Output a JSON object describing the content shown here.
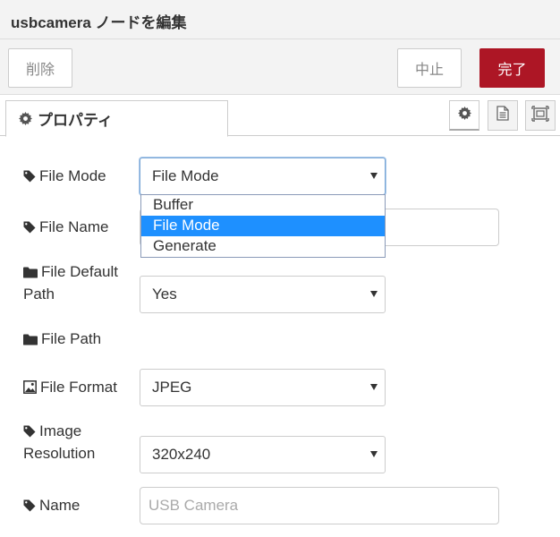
{
  "header": {
    "title": "usbcamera ノードを編集"
  },
  "toolbar": {
    "delete_label": "削除",
    "cancel_label": "中止",
    "done_label": "完了"
  },
  "tabs": {
    "properties_label": "プロパティ"
  },
  "form": {
    "file_mode": {
      "label": "File Mode",
      "value": "File Mode",
      "options": [
        "Buffer",
        "File Mode",
        "Generate"
      ]
    },
    "file_name": {
      "label": "File Name",
      "value": ""
    },
    "file_default_path": {
      "label_line1": "File Default",
      "label_line2": "Path",
      "value": "Yes"
    },
    "file_path": {
      "label": "File Path"
    },
    "file_format": {
      "label": "File Format",
      "value": "JPEG"
    },
    "image_resolution": {
      "label_line1": "Image",
      "label_line2": "Resolution",
      "value": "320x240"
    },
    "name": {
      "label": "Name",
      "placeholder": "USB Camera"
    }
  },
  "colors": {
    "done_button": "#ad1625",
    "selected_option": "#1e90ff"
  }
}
